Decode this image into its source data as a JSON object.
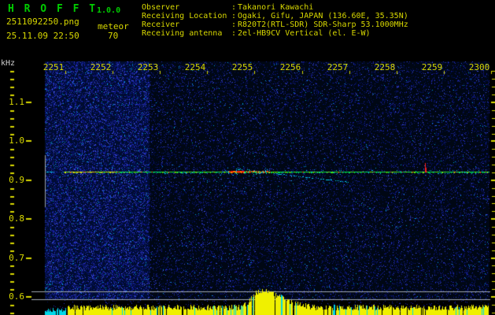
{
  "header": {
    "title": "H R O F F T",
    "version": "1.0.0",
    "filename": "2511092250.png",
    "mode": "meteor",
    "timestamp": "25.11.09 22:50",
    "count": "70",
    "colon": ":",
    "info_rows": [
      {
        "label": "Observer",
        "value": "Takanori Kawachi"
      },
      {
        "label": "Receiving Location",
        "value": "Ogaki, Gifu, JAPAN (136.60E, 35.35N)"
      },
      {
        "label": "Receiver",
        "value": "R820T2(RTL-SDR) SDR-Sharp 53.1000MHz"
      },
      {
        "label": "Receiving antenna",
        "value": "2el-HB9CV Vertical (el. E-W)"
      }
    ]
  },
  "colors": {
    "background": "#000000",
    "text_yellow": "#d8d800",
    "title_green": "#00cc00",
    "text_white": "#d0d0d0",
    "grid_gray": "#a0a8b0",
    "histogram_yellow": "#f0f000",
    "histogram_cyan": "#00d8e8",
    "signal_green": "#00e050",
    "signal_red": "#ff2020",
    "signal_cyan": "#00d8ff",
    "noise_dark_blue": "#101890"
  },
  "chart_data": {
    "type": "heatmap",
    "title": "HROFFT 10-minute meteor radio observation spectrogram",
    "x_axis": {
      "ticks": [
        "2251",
        "2252",
        "2253",
        "2254",
        "2255",
        "2256",
        "2257",
        "2258",
        "2259",
        "2300"
      ],
      "span_minutes": 10
    },
    "y_axis": {
      "label": "kHz",
      "ticks": [
        "1.1",
        "1.0",
        "0.9",
        "0.8",
        "0.7",
        "0.6"
      ],
      "range_khz": [
        0.55,
        1.2
      ],
      "minor_step_khz": 0.02
    },
    "carrier_line_khz": 0.92,
    "features": [
      {
        "time": "2250.5",
        "type": "carrier-start",
        "description": "continuous green/yellow carrier trace begins at 0.92 kHz"
      },
      {
        "time": "2255",
        "type": "meteor-echo",
        "description": "strong red/yellow overdense echo burst on carrier with cyan scatter and descending doppler trail to ~0.89 kHz"
      },
      {
        "time": "2258.5",
        "type": "ping",
        "description": "short red vertical spike rising above carrier line"
      }
    ],
    "noise_floor": {
      "bright_region_until": "2252.3",
      "description": "denser bright-blue noise speckle in first ~2.3 minutes"
    },
    "bottom_histogram": {
      "description": "per-second signal level bars along bottom strip",
      "startup_cyan_until": "2250.5",
      "peak_time": "2254.8",
      "peak_relative_height": 1.0,
      "baseline_relative_height": 0.35,
      "cyan_dropout_stripes": true
    },
    "reference_lines_khz": [
      0.62,
      0.6
    ]
  }
}
